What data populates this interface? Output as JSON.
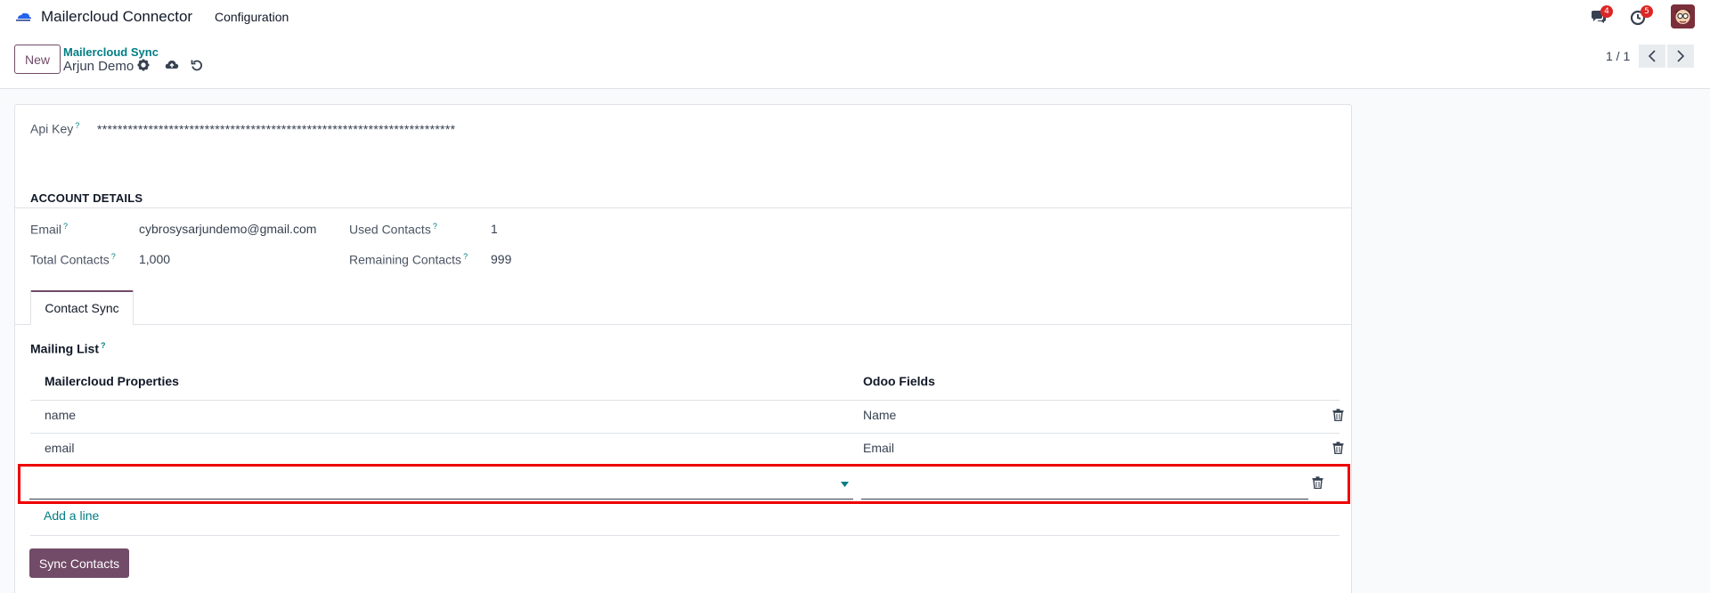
{
  "navbar": {
    "app_title": "Mailercloud Connector",
    "menu_configuration": "Configuration",
    "messages_count": "4",
    "activities_count": "5"
  },
  "control_panel": {
    "new_label": "New",
    "breadcrumb_parent": "Mailercloud Sync",
    "breadcrumb_current": "Arjun Demo",
    "pager": "1 / 1"
  },
  "form": {
    "api_key_label": "Api Key",
    "api_key_value": "**********************************************************************",
    "account_details_title": "ACCOUNT DETAILS",
    "email_label": "Email",
    "email_value": "cybrosysarjundemo@gmail.com",
    "used_contacts_label": "Used Contacts",
    "used_contacts_value": "1",
    "total_contacts_label": "Total Contacts",
    "total_contacts_value": "1,000",
    "remaining_contacts_label": "Remaining Contacts",
    "remaining_contacts_value": "999",
    "tab_contact_sync": "Contact Sync",
    "mailing_list_label": "Mailing List",
    "help_mark": "?"
  },
  "table": {
    "headers": [
      "Mailercloud Properties",
      "Odoo Fields"
    ],
    "rows": [
      {
        "property": "name",
        "field": "Name"
      },
      {
        "property": "email",
        "field": "Email"
      }
    ],
    "add_line": "Add a line"
  },
  "actions": {
    "sync_contacts": "Sync Contacts"
  },
  "colors": {
    "primary": "#714b67",
    "link": "#017e84",
    "highlight": "#ee0000",
    "badge": "#dc2626"
  }
}
